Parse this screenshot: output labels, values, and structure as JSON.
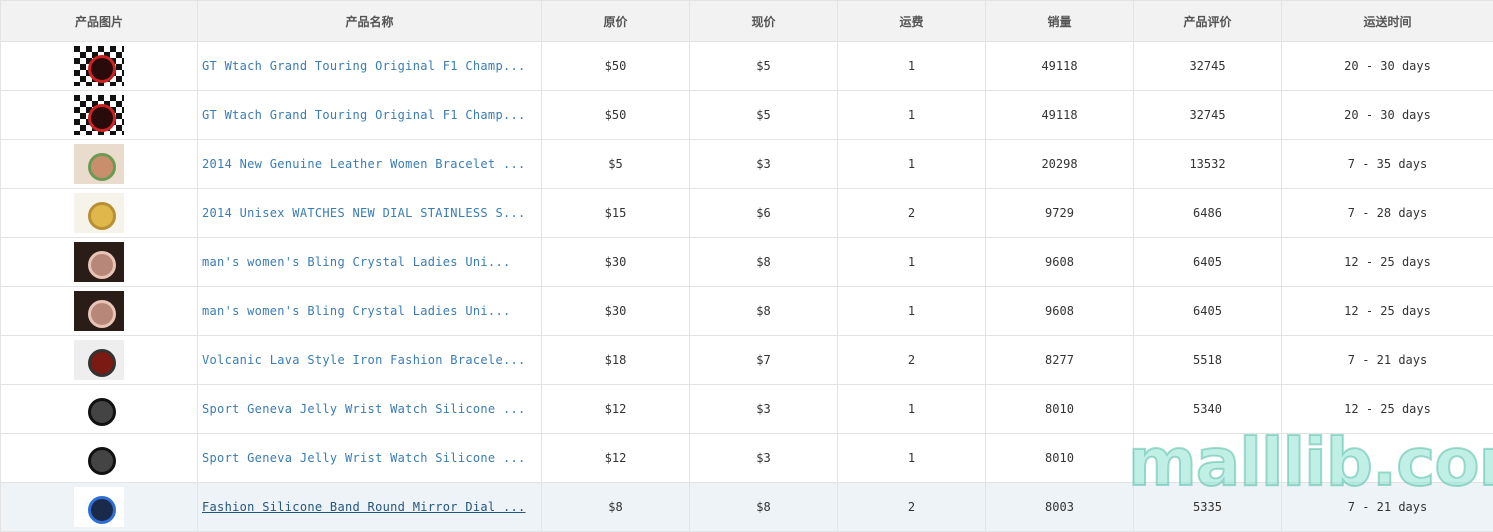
{
  "columns": [
    "产品图片",
    "产品名称",
    "原价",
    "现价",
    "运费",
    "销量",
    "产品评价",
    "运送时间"
  ],
  "rows": [
    {
      "thumb_icon": "checkered-watch-icon",
      "name": "GT Wtach Grand Touring Original F1 Champ...",
      "orig_price": "$50",
      "price": "$5",
      "shipping": "1",
      "sales": "49118",
      "reviews": "32745",
      "delivery": "20 - 30 days"
    },
    {
      "thumb_icon": "checkered-watch-icon",
      "name": "GT Wtach Grand Touring Original F1 Champ...",
      "orig_price": "$50",
      "price": "$5",
      "shipping": "1",
      "sales": "49118",
      "reviews": "32745",
      "delivery": "20 - 30 days"
    },
    {
      "thumb_icon": "leather-bracelet-watches-icon",
      "name": "2014 New Genuine Leather Women Bracelet ...",
      "orig_price": "$5",
      "price": "$3",
      "shipping": "1",
      "sales": "20298",
      "reviews": "13532",
      "delivery": "7 - 35 days"
    },
    {
      "thumb_icon": "gold-steel-watches-icon",
      "name": "2014 Unisex WATCHES NEW DIAL STAINLESS S...",
      "orig_price": "$15",
      "price": "$6",
      "shipping": "2",
      "sales": "9729",
      "reviews": "6486",
      "delivery": "7 - 28 days"
    },
    {
      "thumb_icon": "crystal-ladies-watches-icon",
      "name": "man's women's Bling Crystal Ladies Uni...",
      "orig_price": "$30",
      "price": "$8",
      "shipping": "1",
      "sales": "9608",
      "reviews": "6405",
      "delivery": "12 - 25 days"
    },
    {
      "thumb_icon": "crystal-ladies-watches-icon",
      "name": "man's women's Bling Crystal Ladies Uni...",
      "orig_price": "$30",
      "price": "$8",
      "shipping": "1",
      "sales": "9608",
      "reviews": "6405",
      "delivery": "12 - 25 days"
    },
    {
      "thumb_icon": "lava-led-bracelet-icon",
      "name": "Volcanic Lava Style Iron Fashion Bracele...",
      "orig_price": "$18",
      "price": "$7",
      "shipping": "2",
      "sales": "8277",
      "reviews": "5518",
      "delivery": "7 - 21 days"
    },
    {
      "thumb_icon": "jelly-sport-watch-icon",
      "name": "Sport Geneva Jelly Wrist Watch Silicone ...",
      "orig_price": "$12",
      "price": "$3",
      "shipping": "1",
      "sales": "8010",
      "reviews": "5340",
      "delivery": "12 - 25 days"
    },
    {
      "thumb_icon": "jelly-sport-watch-icon",
      "name": "Sport Geneva Jelly Wrist Watch Silicone ...",
      "orig_price": "$12",
      "price": "$3",
      "shipping": "1",
      "sales": "8010",
      "reviews": "",
      "delivery": ""
    },
    {
      "thumb_icon": "mirror-dial-watch-icon",
      "name": "Fashion Silicone Band Round Mirror Dial ...",
      "orig_price": "$8",
      "price": "$8",
      "shipping": "2",
      "sales": "8003",
      "reviews": "5335",
      "delivery": "7 - 21 days"
    }
  ],
  "watermark": "malllib.com",
  "colors": {
    "link": "#3a7cb5",
    "header_bg": "#f2f2f2",
    "highlight_row": "#eef3f7",
    "watermark": "#8ce1d2"
  }
}
